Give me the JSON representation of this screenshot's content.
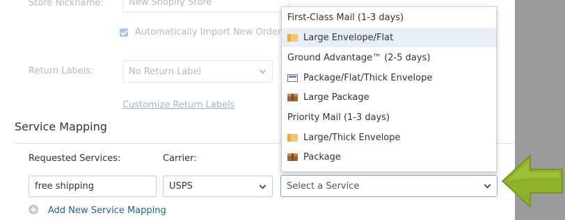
{
  "store_nickname": {
    "label": "Store Nickname:",
    "value": "New Shopify Store"
  },
  "auto_import": {
    "label": "Automatically Import New Orders",
    "checked": true
  },
  "return_labels": {
    "label": "Return Labels:",
    "value": "No Return Label",
    "customize_link": "Customize Return Labels"
  },
  "service_mapping": {
    "title": "Service Mapping",
    "requested_label": "Requested Services:",
    "carrier_label": "Carrier:",
    "requested_value": "free shipping",
    "carrier_value": "USPS",
    "service_placeholder": "Select a Service",
    "add_link": "Add New Service Mapping"
  },
  "dropdown": {
    "groups": [
      {
        "header": "First-Class Mail (1-3 days)",
        "options": [
          {
            "label": "Large Envelope/Flat",
            "icon": "envelope-icon",
            "highlighted": true
          }
        ]
      },
      {
        "header": "Ground Advantage™ (2-5 days)",
        "options": [
          {
            "label": "Package/Flat/Thick Envelope",
            "icon": "package-flat-icon"
          },
          {
            "label": "Large Package",
            "icon": "box-icon"
          }
        ]
      },
      {
        "header": "Priority Mail (1-3 days)",
        "options": [
          {
            "label": "Large/Thick Envelope",
            "icon": "envelope-icon"
          },
          {
            "label": "Package",
            "icon": "box-icon"
          }
        ]
      }
    ]
  },
  "colors": {
    "arrow": "#8fb12a",
    "link": "#1b5fa8",
    "highlight": "#e8eff8"
  }
}
